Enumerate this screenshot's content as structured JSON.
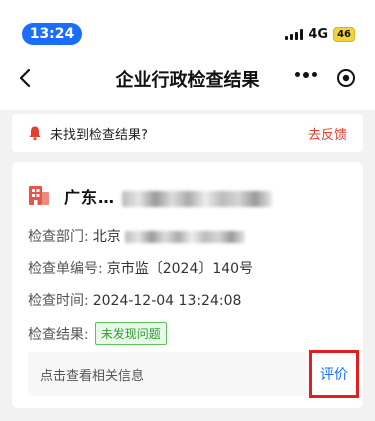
{
  "status_bar": {
    "time": "13:24",
    "network": "4G",
    "battery": "46"
  },
  "nav": {
    "title": "企业行政检查结果"
  },
  "alert": {
    "text": "未找到检查结果?",
    "link": "去反馈"
  },
  "result": {
    "company_name": "广东…",
    "department_label": "检查部门:",
    "department_value": "北京",
    "number_label": "检查单编号:",
    "number_value": "京市监〔2024〕140号",
    "time_label": "检查时间:",
    "time_value": "2024-12-04 13:24:08",
    "result_label": "检查结果:",
    "result_tag": "未发现问题",
    "footer_text": "点击查看相关信息",
    "rate_label": "评价"
  },
  "colors": {
    "accent": "#1a6dff",
    "alert": "#e23d2d",
    "success": "#2e9e33",
    "highlight": "#e02020"
  },
  "icons": [
    "back-icon",
    "more-icon",
    "target-icon",
    "bell-icon",
    "building-icon"
  ]
}
